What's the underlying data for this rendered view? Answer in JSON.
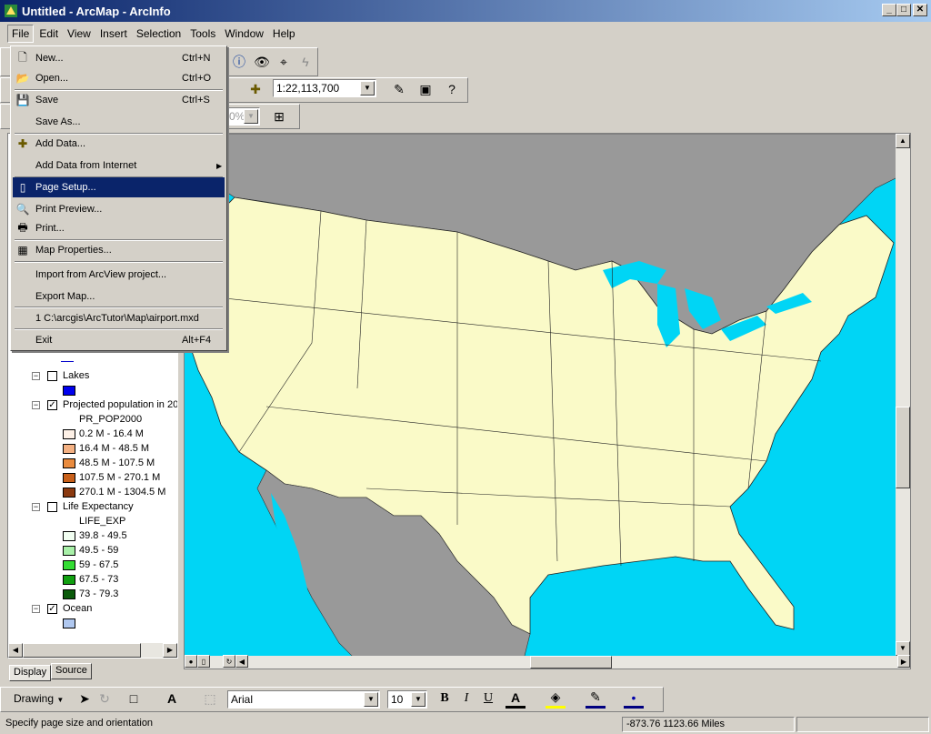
{
  "window": {
    "title": "Untitled - ArcMap - ArcInfo"
  },
  "menubar": [
    "File",
    "Edit",
    "View",
    "Insert",
    "Selection",
    "Tools",
    "Window",
    "Help"
  ],
  "toolbar": {
    "scale": "1:22,113,700",
    "zoom": "0%"
  },
  "file_menu": [
    {
      "label": "New...",
      "shortcut": "Ctrl+N",
      "icon": "new-document-icon"
    },
    {
      "label": "Open...",
      "shortcut": "Ctrl+O",
      "icon": "open-folder-icon"
    },
    {
      "label": "Save",
      "shortcut": "Ctrl+S",
      "icon": "save-disk-icon"
    },
    {
      "label": "Save As...",
      "shortcut": "",
      "icon": ""
    },
    {
      "label": "Add Data...",
      "shortcut": "",
      "icon": "add-data-icon"
    },
    {
      "label": "Add Data from Internet",
      "shortcut": "",
      "icon": "",
      "submenu": true
    },
    {
      "label": "Page Setup...",
      "shortcut": "",
      "icon": "page-setup-icon",
      "selected": true
    },
    {
      "label": "Print Preview...",
      "shortcut": "",
      "icon": "print-preview-icon"
    },
    {
      "label": "Print...",
      "shortcut": "",
      "icon": "printer-icon"
    },
    {
      "label": "Map Properties...",
      "shortcut": "",
      "icon": "map-properties-icon"
    },
    {
      "label": "Import from ArcView project...",
      "shortcut": "",
      "icon": ""
    },
    {
      "label": "Export Map...",
      "shortcut": "",
      "icon": ""
    },
    {
      "label": "1 C:\\arcgis\\ArcTutor\\Map\\airport.mxd",
      "shortcut": "",
      "icon": ""
    },
    {
      "label": "Exit",
      "shortcut": "Alt+F4",
      "icon": ""
    }
  ],
  "toc": {
    "layers": [
      {
        "name": "Lakes",
        "checked": false,
        "swatch": "#0000ee"
      },
      {
        "name": "Projected population in 20",
        "checked": true,
        "field": "PR_POP2000",
        "classes": [
          {
            "label": "0.2 M - 16.4 M",
            "color": "#fdf0e6"
          },
          {
            "label": "16.4 M - 48.5 M",
            "color": "#f4b183"
          },
          {
            "label": "48.5 M - 107.5 M",
            "color": "#e98b3e"
          },
          {
            "label": "107.5 M - 270.1 M",
            "color": "#c8601a"
          },
          {
            "label": "270.1 M - 1304.5 M",
            "color": "#8b3a10"
          }
        ]
      },
      {
        "name": "Life Expectancy",
        "checked": false,
        "field": "LIFE_EXP",
        "classes": [
          {
            "label": "39.8 - 49.5",
            "color": "#f2fff2"
          },
          {
            "label": "49.5 - 59",
            "color": "#a8f0a8"
          },
          {
            "label": "59 - 67.5",
            "color": "#33dd33"
          },
          {
            "label": "67.5 - 73",
            "color": "#11a011"
          },
          {
            "label": "73 - 79.3",
            "color": "#0a5a0a"
          }
        ]
      },
      {
        "name": "Ocean",
        "checked": true,
        "swatch": "#b0c8f0"
      }
    ],
    "tabs": [
      "Display",
      "Source"
    ]
  },
  "drawing_toolbar": {
    "label": "Drawing",
    "font": "Arial",
    "size": "10",
    "bold": "B",
    "italic": "I",
    "underline": "U"
  },
  "statusbar": {
    "message": "Specify page size and orientation",
    "coords": "-873.76  1123.66 Miles"
  }
}
